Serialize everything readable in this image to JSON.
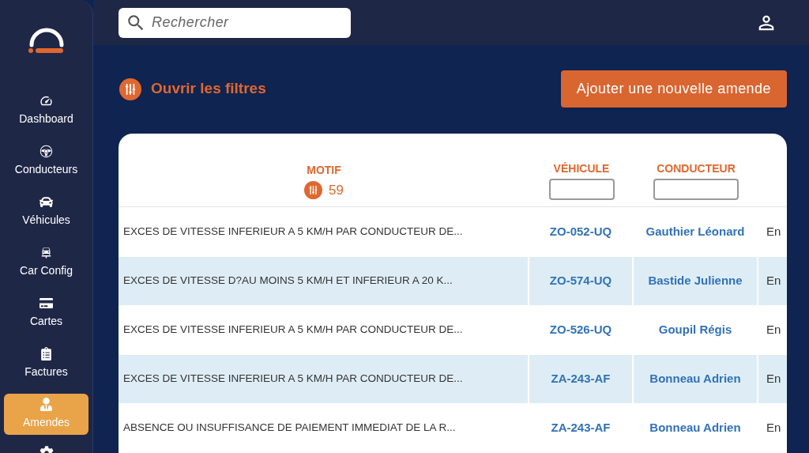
{
  "sidebar": {
    "items": [
      {
        "label": "Dashboard",
        "selected": false
      },
      {
        "label": "Conducteurs",
        "selected": false
      },
      {
        "label": "Véhicules",
        "selected": false
      },
      {
        "label": "Car Config",
        "selected": false
      },
      {
        "label": "Cartes",
        "selected": false
      },
      {
        "label": "Factures",
        "selected": false
      },
      {
        "label": "Amendes",
        "selected": true
      }
    ]
  },
  "search": {
    "placeholder": "Rechercher"
  },
  "filters_link": "Ouvrir les filtres",
  "add_button": "Ajouter une nouvelle amende",
  "table": {
    "columns": [
      {
        "label": "MOTIF",
        "kind": "count",
        "count": "59"
      },
      {
        "label": "VÉHICULE",
        "kind": "input"
      },
      {
        "label": "CONDUCTEUR",
        "kind": "input"
      }
    ],
    "rows": [
      {
        "motif": "EXCES DE VITESSE INFERIEUR A 5 KM/H PAR CONDUCTEUR DE...",
        "vehicle": "ZO-052-UQ",
        "driver": "Gauthier Léonard",
        "column_4": "En"
      },
      {
        "motif": "EXCES DE VITESSE D?AU MOINS 5 KM/H ET INFERIEUR A 20 K...",
        "vehicle": "ZO-574-UQ",
        "driver": "Bastide Julienne",
        "column_4": "En"
      },
      {
        "motif": "EXCES DE VITESSE INFERIEUR A 5 KM/H PAR CONDUCTEUR DE...",
        "vehicle": "ZO-526-UQ",
        "driver": "Goupil Régis",
        "column_4": "En"
      },
      {
        "motif": "EXCES DE VITESSE INFERIEUR A 5 KM/H PAR CONDUCTEUR DE...",
        "vehicle": "ZA-243-AF",
        "driver": "Bonneau Adrien",
        "column_4": "En"
      },
      {
        "motif": "ABSENCE OU INSUFFISANCE DE PAIEMENT IMMEDIAT DE LA R...",
        "vehicle": "ZA-243-AF",
        "driver": "Bonneau Adrien",
        "column_4": "En"
      }
    ]
  }
}
